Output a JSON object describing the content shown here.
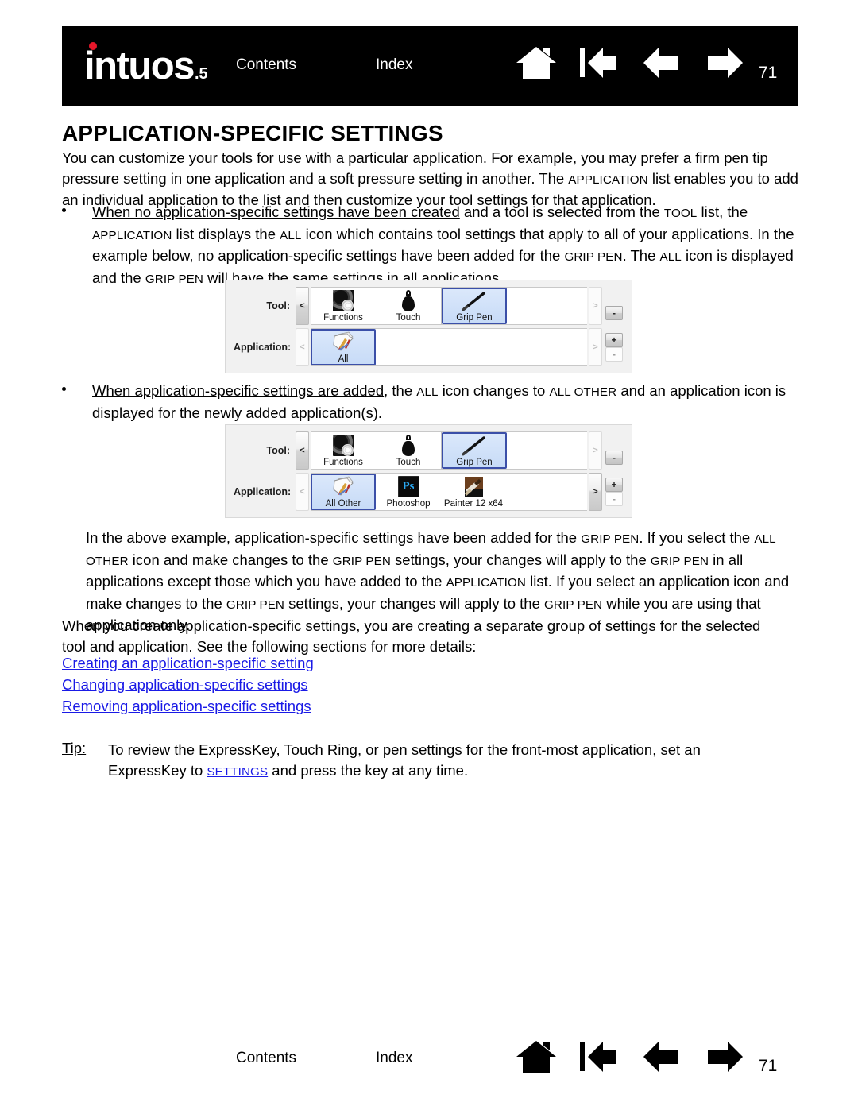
{
  "header": {
    "logo_text": "intuos",
    "logo_sub": ".5",
    "contents_label": "Contents",
    "index_label": "Index",
    "page_number": "71",
    "icons": [
      {
        "name": "home-icon",
        "label": "Home"
      },
      {
        "name": "first-page-icon",
        "label": "First page"
      },
      {
        "name": "previous-page-icon",
        "label": "Previous page"
      },
      {
        "name": "next-page-icon",
        "label": "Next page"
      }
    ],
    "accent_color": "#e8172a",
    "bar_color": "#000000"
  },
  "footer": {
    "contents_label": "Contents",
    "index_label": "Index",
    "page_number": "71"
  },
  "content": {
    "heading": "APPLICATION-SPECIFIC SETTINGS",
    "intro": {
      "l1_a": "You can customize your tools for use with a particular application.  For example, you may prefer a firm pen",
      "l2_a": "tip pressure setting in one application and a soft pressure setting in another.  The ",
      "l2_sc": "APPLICATION",
      "l2_b": " list enables",
      "l3_a": "you to add an individual application to the list and then customize your tool settings for that application."
    },
    "bullet1": {
      "link": "When no application-specific settings have been created",
      "a": " and a tool is selected from the ",
      "sc1": "TOOL",
      "b": " list, the",
      "sc2": "APPLICATION",
      "c": " list displays the ",
      "sc3": "ALL",
      "d": " icon which contains tool settings that apply to all of your applications.",
      "e": "In the example below, no application-specific settings have been added for the ",
      "sc4": "GRIP PEN",
      "f": ".  The ",
      "sc5": "ALL",
      "g": " icon",
      "h": "is displayed and the ",
      "sc6": "GRIP PEN",
      "i": " will have the same settings in all applications."
    },
    "bullet2": {
      "link": "When application-specific settings are added",
      "a": ", the ",
      "sc1": "ALL",
      "b": " icon changes to ",
      "sc2": "ALL OTHER",
      "c": " and an application",
      "d": "icon is displayed for the newly added application(s)."
    },
    "para3": {
      "l1_a": "In the above example, application-specific settings have been added for the ",
      "l1_sc": "GRIP PEN",
      "l1_b": ".  If you select the",
      "l2_sc1": "ALL OTHER",
      "l2_a": " icon and make changes to the ",
      "l2_sc2": "GRIP PEN",
      "l2_b": " settings, your changes will apply to the ",
      "l2_sc3": "GRIP PEN",
      "l2_c": " in",
      "l3_a": "all applications except those which you have added to the ",
      "l3_sc": "APPLICATION",
      "l3_b": " list.  If you select an application",
      "l4_a": "icon and make changes to the ",
      "l4_sc1": "GRIP PEN",
      "l4_b": " settings, your changes will apply to the ",
      "l4_sc2": "GRIP PEN",
      "l4_c": " while you are",
      "l5_a": "using that application only."
    },
    "para4": {
      "l1": "When you create application-specific settings, you are creating a separate group of settings for the",
      "l2": "selected tool and application.  See the following sections for more details:"
    },
    "links": [
      "Creating an application-specific setting",
      "Changing application-specific settings",
      "Removing application-specific settings"
    ],
    "tip": {
      "label": "Tip:",
      "l1": "To review the ExpressKey, Touch Ring, or pen settings for the front-most application, set an",
      "l2_a": "ExpressKey to ",
      "l2_link": "SETTINGS",
      "l2_b": " and press the key at any time."
    },
    "link_color": "#1a1ae6"
  },
  "panel1": {
    "tool_row": {
      "label": "Tool:",
      "prev_arrow": "<",
      "next_arrow": ">",
      "prev_enabled": true,
      "next_enabled": false,
      "items": [
        {
          "caption": "Functions",
          "icon": "functions-icon",
          "selected": false
        },
        {
          "caption": "Touch",
          "icon": "touch-icon",
          "selected": false
        },
        {
          "caption": "Grip Pen",
          "icon": "grip-pen-icon",
          "selected": true
        }
      ],
      "minus_label": "-"
    },
    "app_row": {
      "label": "Application:",
      "prev_arrow": "<",
      "next_arrow": ">",
      "prev_enabled": false,
      "next_enabled": false,
      "items": [
        {
          "caption": "All",
          "icon": "all-applications-icon",
          "selected": true
        }
      ],
      "plus_label": "+",
      "minus_label": "-"
    }
  },
  "panel2": {
    "tool_row": {
      "label": "Tool:",
      "prev_arrow": "<",
      "next_arrow": ">",
      "prev_enabled": true,
      "next_enabled": false,
      "items": [
        {
          "caption": "Functions",
          "icon": "functions-icon",
          "selected": false
        },
        {
          "caption": "Touch",
          "icon": "touch-icon",
          "selected": false
        },
        {
          "caption": "Grip Pen",
          "icon": "grip-pen-icon",
          "selected": true
        }
      ],
      "minus_label": "-"
    },
    "app_row": {
      "label": "Application:",
      "prev_arrow": "<",
      "next_arrow": ">",
      "prev_enabled": false,
      "next_enabled": true,
      "items": [
        {
          "caption": "All Other",
          "icon": "all-other-applications-icon",
          "selected": true
        },
        {
          "caption": "Photoshop",
          "icon": "photoshop-icon",
          "selected": false
        },
        {
          "caption": "Painter 12 x64",
          "icon": "painter-icon",
          "selected": false
        }
      ],
      "plus_label": "+",
      "minus_label": "-"
    }
  }
}
